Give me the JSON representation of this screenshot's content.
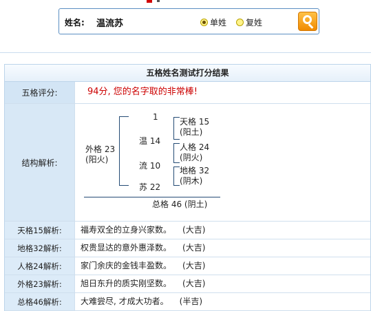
{
  "search": {
    "label": "姓名:",
    "value": "温流苏",
    "options": [
      {
        "label": "单姓",
        "selected": true
      },
      {
        "label": "复姓",
        "selected": false
      }
    ],
    "button_icon": "search-icon"
  },
  "result": {
    "title": "五格姓名测试打分结果",
    "score_label": "五格评分:",
    "score_text": "94分, 您的名字取的非常棒!",
    "structure_label": "结构解析:",
    "structure": {
      "top": "1",
      "c1": "温 14",
      "c2": "流 10",
      "c3": "苏 22",
      "outer_1": "外格 23",
      "outer_2": "(阳火)",
      "tian_1": "天格 15",
      "tian_2": "(阳土)",
      "ren_1": "人格 24",
      "ren_2": "(阴火)",
      "di_1": "地格 32",
      "di_2": "(阴木)",
      "total": "总格 46 (阴土)"
    },
    "explain": [
      {
        "label": "天格15解析:",
        "text": "福寿双全的立身兴家数。",
        "luck": "(大吉)"
      },
      {
        "label": "地格32解析:",
        "text": "权贵显达的意外惠泽数。",
        "luck": "(大吉)"
      },
      {
        "label": "人格24解析:",
        "text": "家门余庆的金钱丰盈数。",
        "luck": "(大吉)"
      },
      {
        "label": "外格23解析:",
        "text": "旭日东升的质实刚坚数。",
        "luck": "(大吉)"
      },
      {
        "label": "总格46解析:",
        "text": "大难尝尽, 才成大功者。",
        "luck": "(半吉)"
      }
    ]
  },
  "colors": {
    "accent_border": "#5a8ec2",
    "label_bg": "#dcebf8",
    "score_text": "#cc0000",
    "line": "#234a74",
    "search_button": "#f08a00"
  }
}
